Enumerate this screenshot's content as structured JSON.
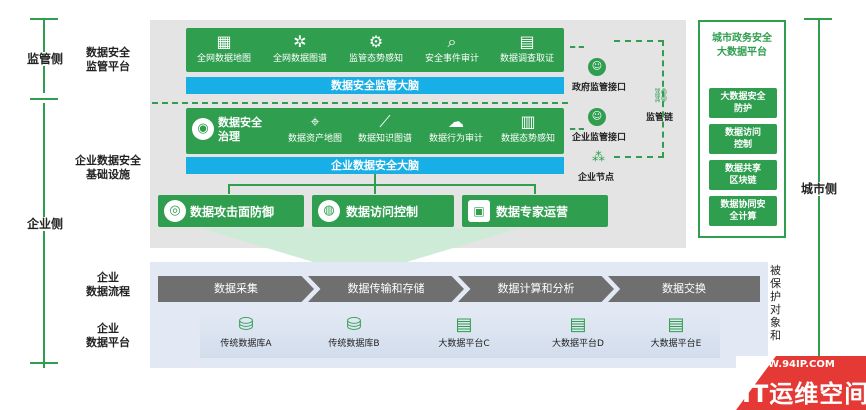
{
  "left": {
    "supervision_side": "监管侧",
    "supervision_platform": "数据安全\n监管平台",
    "enterprise_infra": "企业数据安全\n基础设施",
    "enterprise_side": "企业侧",
    "enterprise_flow": "企业\n数据流程",
    "enterprise_platform": "企业\n数据平台"
  },
  "supervision": {
    "items": [
      {
        "label": "全网数据地图",
        "icon": "map-icon"
      },
      {
        "label": "全网数据图谱",
        "icon": "graph-icon"
      },
      {
        "label": "监管态势感知",
        "icon": "network-icon"
      },
      {
        "label": "安全事件审计",
        "icon": "magnify-icon"
      },
      {
        "label": "数据调查取证",
        "icon": "clipboard-icon"
      }
    ],
    "brain": "数据安全监管大脑"
  },
  "enterprise": {
    "governance": "数据安全\n治理",
    "items": [
      {
        "label": "数据资产地图",
        "icon": "location-icon"
      },
      {
        "label": "数据知识图谱",
        "icon": "chart-line-icon"
      },
      {
        "label": "数据行为审计",
        "icon": "cloud-icon"
      },
      {
        "label": "数据态势感知",
        "icon": "bar-chart-icon"
      }
    ],
    "brain": "企业数据安全大脑",
    "bottom": [
      {
        "label": "数据攻击面防御",
        "icon": "fingerprint-icon"
      },
      {
        "label": "数据访问控制",
        "icon": "globe-icon"
      },
      {
        "label": "数据专家运营",
        "icon": "presenter-icon"
      }
    ]
  },
  "links": {
    "gov_interface": "政府监管接口",
    "ent_interface": "企业监管接口",
    "supervision_chain": "监管链",
    "ent_node": "企业节点"
  },
  "city": {
    "platform": "城市政务安全\n大数据平台",
    "items": [
      "大数据安全\n防护",
      "数据访问\n控制",
      "数据共享\n区块链",
      "数据协同安\n全计算"
    ],
    "side": "城市侧"
  },
  "flow": {
    "steps": [
      "数据采集",
      "数据传输和存储",
      "数据计算和分析",
      "数据交换"
    ],
    "protected": "被保护对象和"
  },
  "platforms": [
    "传统数据库A",
    "传统数据库B",
    "大数据平台C",
    "大数据平台D",
    "大数据平台E"
  ],
  "watermark": {
    "url": "WWW.94IP.COM",
    "brand": "IT运维空间"
  }
}
